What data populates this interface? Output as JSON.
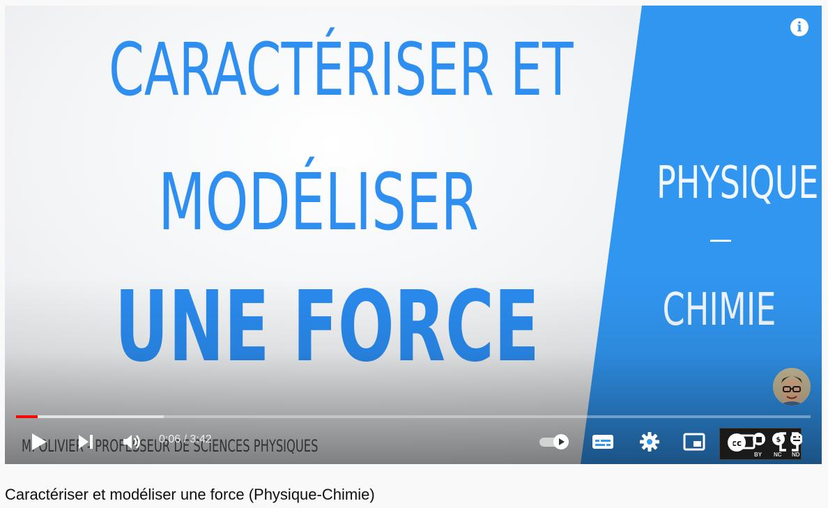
{
  "video": {
    "thumbnail": {
      "line1": "CARACTÉRISER ET",
      "line2": "MODÉLISER",
      "line3": "UNE FORCE",
      "subject_top": "PHYSIQUE",
      "subject_bottom": "CHIMIE",
      "author": "M. OLIVIER - PROFESSEUR DE SCIENCES PHYSIQUES"
    },
    "info_icon": "info-icon",
    "controls": {
      "time": "0:06 / 3:42",
      "progress_played": 0.027,
      "progress_buffered": 0.186
    },
    "license": {
      "labels": [
        "BY",
        "NC",
        "ND"
      ]
    },
    "colors": {
      "accent_blue": "#3196f0",
      "progress_red": "#ff0000"
    }
  },
  "caption": "Caractériser et modéliser une force (Physique-Chimie)"
}
